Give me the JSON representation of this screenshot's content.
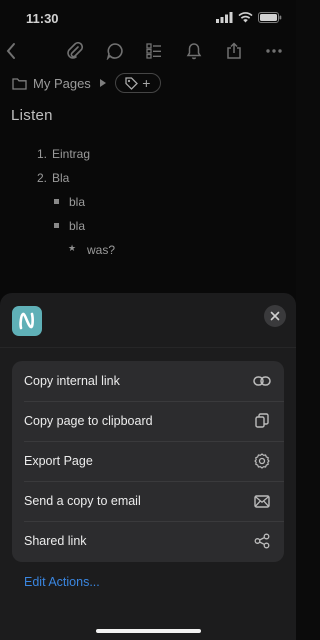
{
  "status": {
    "time": "11:30"
  },
  "breadcrumb": {
    "label": "My Pages",
    "tag_add": "+"
  },
  "page": {
    "title": "Listen",
    "list": [
      {
        "marker": "1.",
        "text": "Eintrag"
      },
      {
        "marker": "2.",
        "text": "Bla"
      },
      {
        "text": "bla"
      },
      {
        "text": "bla"
      },
      {
        "marker": "★",
        "text": "was?"
      }
    ]
  },
  "sheet": {
    "app_icon_letter": "N",
    "actions": [
      {
        "label": "Copy internal link",
        "icon": "link-icon"
      },
      {
        "label": "Copy page to clipboard",
        "icon": "copy-icon"
      },
      {
        "label": "Export Page",
        "icon": "gear-icon"
      },
      {
        "label": "Send a copy to email",
        "icon": "mail-icon"
      },
      {
        "label": "Shared link",
        "icon": "share-nodes-icon"
      }
    ],
    "edit_actions": "Edit Actions..."
  },
  "colors": {
    "accent": "#3a86e0",
    "app_icon": "#5fb0b7"
  }
}
